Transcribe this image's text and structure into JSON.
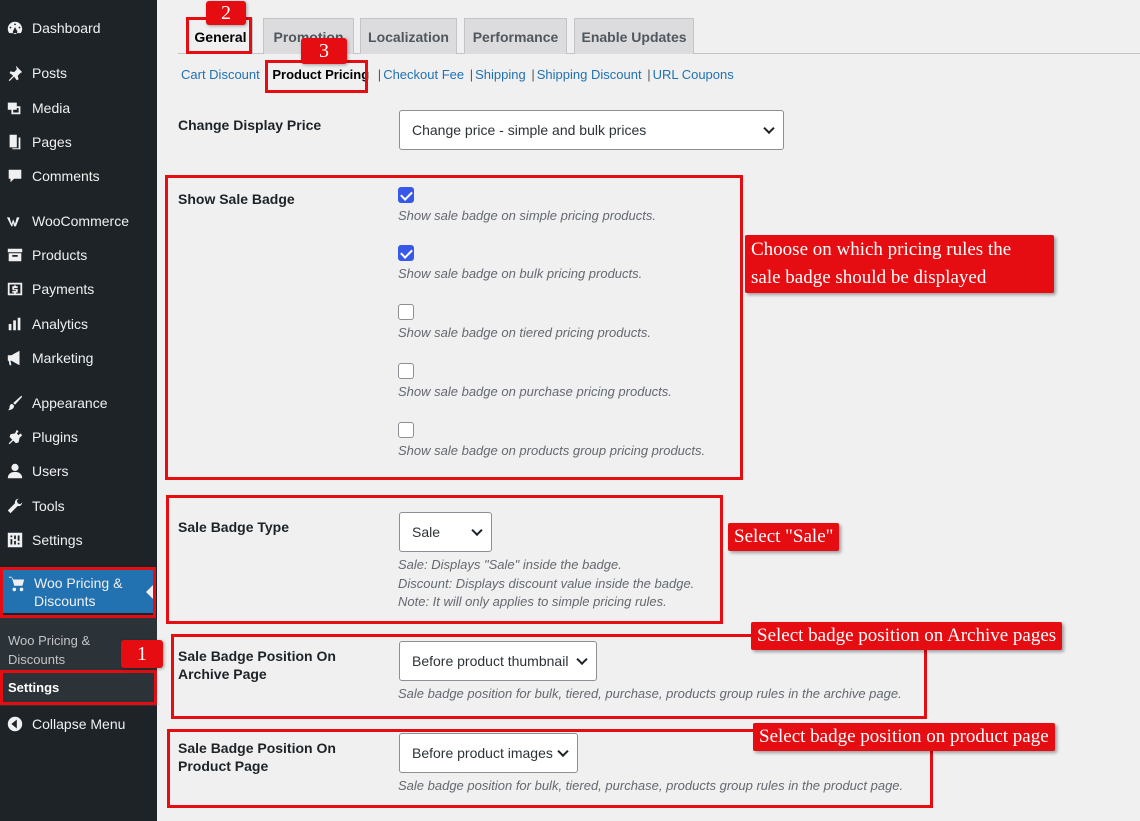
{
  "sidebar": {
    "items": [
      {
        "label": "Dashboard",
        "icon": "dashboard-icon"
      },
      {
        "label": "Posts",
        "icon": "pin-icon"
      },
      {
        "label": "Media",
        "icon": "media-icon"
      },
      {
        "label": "Pages",
        "icon": "pages-icon"
      },
      {
        "label": "Comments",
        "icon": "comment-icon"
      },
      {
        "label": "WooCommerce",
        "icon": "woocommerce-icon"
      },
      {
        "label": "Products",
        "icon": "archive-icon"
      },
      {
        "label": "Payments",
        "icon": "dollar-icon"
      },
      {
        "label": "Analytics",
        "icon": "bar-chart-icon"
      },
      {
        "label": "Marketing",
        "icon": "megaphone-icon"
      },
      {
        "label": "Appearance",
        "icon": "brush-icon"
      },
      {
        "label": "Plugins",
        "icon": "plugin-icon"
      },
      {
        "label": "Users",
        "icon": "user-icon"
      },
      {
        "label": "Tools",
        "icon": "wrench-icon"
      },
      {
        "label": "Settings",
        "icon": "sliders-icon"
      }
    ],
    "active": {
      "label_line1": "Woo Pricing &",
      "label_line2": "Discounts",
      "icon": "cart-icon"
    },
    "submenu": [
      {
        "label_line1": "Woo Pricing &",
        "label_line2": "Discounts"
      },
      {
        "label": "Settings",
        "current": true
      }
    ],
    "collapse_label": "Collapse Menu"
  },
  "tabs": [
    {
      "label": "General",
      "active": true
    },
    {
      "label": "Promotion"
    },
    {
      "label": "Localization"
    },
    {
      "label": "Performance"
    },
    {
      "label": "Enable Updates"
    }
  ],
  "sublinks": [
    {
      "label": "Cart Discount"
    },
    {
      "label": "Product Pricing",
      "current": true
    },
    {
      "label": "Checkout Fee"
    },
    {
      "label": "Shipping"
    },
    {
      "label": "Shipping Discount"
    },
    {
      "label": "URL Coupons"
    }
  ],
  "form": {
    "change_display_price": {
      "label": "Change Display Price",
      "value": "Change price - simple and bulk prices"
    },
    "show_sale_badge": {
      "label": "Show Sale Badge",
      "options": [
        {
          "checked": true,
          "desc": "Show sale badge on simple pricing products."
        },
        {
          "checked": true,
          "desc": "Show sale badge on bulk pricing products."
        },
        {
          "checked": false,
          "desc": "Show sale badge on tiered pricing products."
        },
        {
          "checked": false,
          "desc": "Show sale badge on purchase pricing products."
        },
        {
          "checked": false,
          "desc": "Show sale badge on products group pricing products."
        }
      ]
    },
    "sale_badge_type": {
      "label": "Sale Badge Type",
      "value": "Sale",
      "desc1": "Sale: Displays \"Sale\" inside the badge.",
      "desc2": "Discount: Displays discount value inside the badge.",
      "desc3": "Note: It will only applies to simple pricing rules."
    },
    "archive_position": {
      "label": "Sale Badge Position On Archive Page",
      "value": "Before product thumbnail",
      "desc": "Sale badge position for bulk, tiered, purchase, products group rules in the archive page."
    },
    "product_position": {
      "label": "Sale Badge Position On Product Page",
      "value": "Before product images",
      "desc": "Sale badge position for bulk, tiered, purchase, products group rules in the product page."
    }
  },
  "annotations": {
    "badges": [
      "1",
      "2",
      "3"
    ],
    "callouts": {
      "pricing_rules_line1": "Choose on which pricing rules the",
      "pricing_rules_line2": "sale badge should be displayed",
      "select_sale": "Select \"Sale\"",
      "archive": "Select badge position on Archive pages",
      "product": "Select badge position on product page"
    },
    "color": "#e50d11"
  },
  "colors": {
    "sidebar_bg": "#1d2327",
    "accent": "#2271b1",
    "checkbox": "#3858e9"
  }
}
